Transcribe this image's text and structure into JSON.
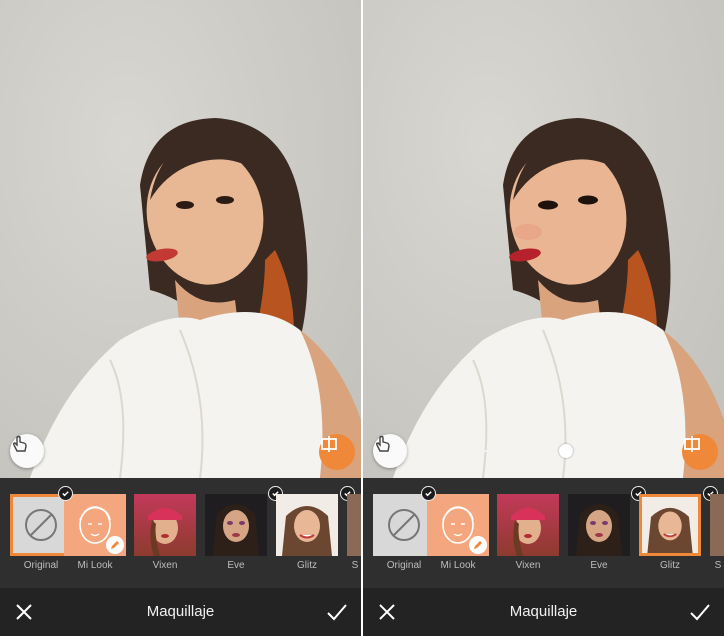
{
  "left": {
    "title": "Maquillaje",
    "looks": [
      {
        "label": "Original"
      },
      {
        "label": "Mi Look"
      },
      {
        "label": "Vixen"
      },
      {
        "label": "Eve"
      },
      {
        "label": "Glitz"
      },
      {
        "label": "S"
      }
    ]
  },
  "right": {
    "title": "Maquillaje",
    "looks": [
      {
        "label": "Original"
      },
      {
        "label": "Mi Look"
      },
      {
        "label": "Vixen"
      },
      {
        "label": "Eve"
      },
      {
        "label": "Glitz"
      },
      {
        "label": "S"
      }
    ],
    "intensity": 0.6
  },
  "colors": {
    "accent": "#f0883a",
    "bar": "#232323",
    "strip": "#2f2f2f"
  },
  "icons": [
    "hand-touch-icon",
    "compare-icon",
    "no-filter-icon",
    "face-outline-icon",
    "pencil-icon",
    "check-icon",
    "close-icon",
    "confirm-check-icon"
  ]
}
